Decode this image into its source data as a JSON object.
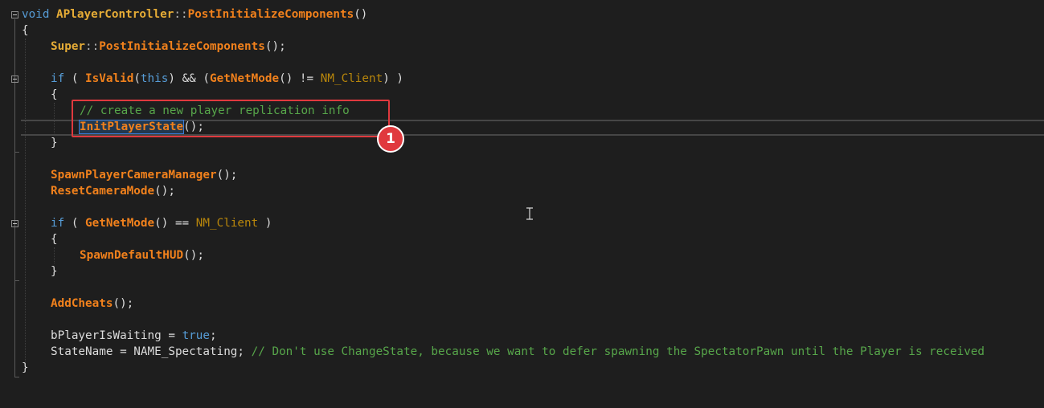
{
  "code": {
    "lines": [
      "void APlayerController::PostInitializeComponents()",
      "{",
      "Super::PostInitializeComponents();",
      "if ( IsValid(this) && (GetNetMode() != NM_Client) )",
      "{",
      "// create a new player replication info",
      "InitPlayerState();",
      "}",
      "SpawnPlayerCameraManager();",
      "ResetCameraMode();",
      "if ( GetNetMode() == NM_Client )",
      "{",
      "SpawnDefaultHUD();",
      "}",
      "AddCheats();",
      "bPlayerIsWaiting = true;",
      "StateName = NAME_Spectating; // Don't use ChangeState, because we want to defer spawning the SpectatorPawn until the Player is received",
      "}"
    ],
    "tokens": {
      "kw_void": "void",
      "cls_name": "APlayerController",
      "scope": "::",
      "fn_post_init": "PostInitializeComponents",
      "parens_empty": "()",
      "brace_open": "{",
      "brace_close": "}",
      "super": "Super",
      "call_end": "();",
      "kw_if": "if",
      "is_valid": "IsValid",
      "kw_this": "this",
      "get_net_mode": "GetNetMode",
      "nm_client": "NM_Client",
      "comment_replication": "// create a new player replication info",
      "init_player_state": "InitPlayerState",
      "spawn_camera_mgr": "SpawnPlayerCameraManager",
      "reset_camera_mode": "ResetCameraMode",
      "spawn_default_hud": "SpawnDefaultHUD",
      "add_cheats": "AddCheats",
      "b_player_is_waiting": "bPlayerIsWaiting",
      "kw_true": "true",
      "state_name": "StateName",
      "name_spectating": "NAME_Spectating",
      "comment_state": "// Don't use ChangeState, because we want to defer spawning the SpectatorPawn until the Player is received"
    }
  },
  "annotation": {
    "badge_number": "1"
  },
  "colors": {
    "background": "#1e1e1e",
    "keyword": "#569cd6",
    "type": "#e6ac36",
    "function": "#f1811c",
    "enum": "#b8860b",
    "comment": "#57a64a",
    "text": "#dcdcdc",
    "annotation": "#e0393e"
  }
}
